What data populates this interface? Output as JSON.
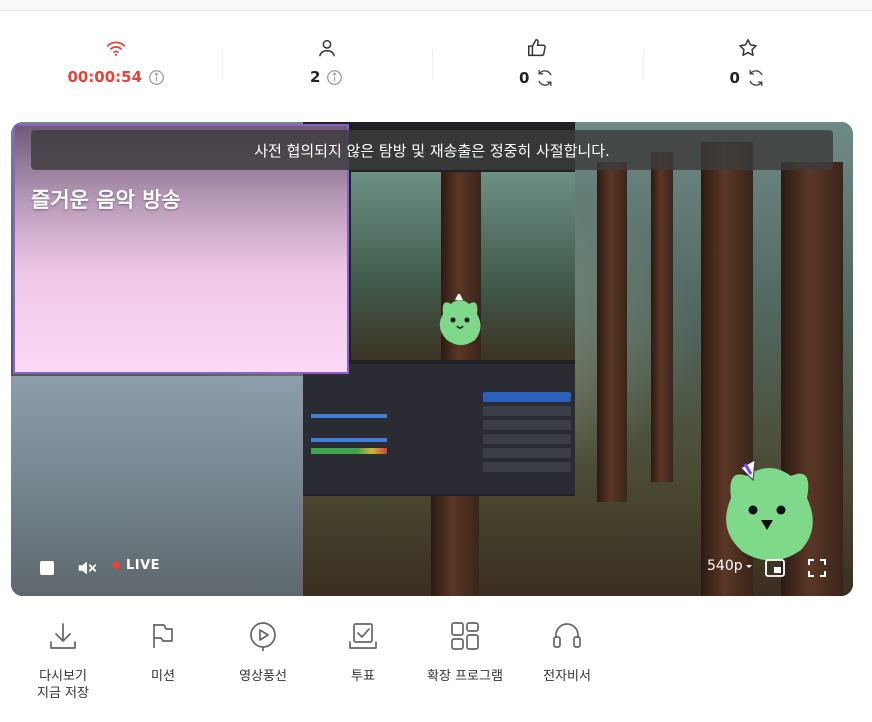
{
  "stats": {
    "live_time": "00:00:54",
    "viewers": "2",
    "likes": "0",
    "favorites": "0"
  },
  "video": {
    "notice": "사전 협의되지 않은 탐방 및 재송출은 정중히 사절합니다.",
    "title": "즐거운 음악 방송",
    "live_label": "LIVE",
    "quality": "540p"
  },
  "tools": [
    {
      "label": "다시보기\n지금 저장",
      "icon": "download-icon"
    },
    {
      "label": "미션",
      "icon": "flag-icon"
    },
    {
      "label": "영상풍선",
      "icon": "video-balloon-icon"
    },
    {
      "label": "투표",
      "icon": "vote-icon"
    },
    {
      "label": "확장 프로그램",
      "icon": "extension-icon"
    },
    {
      "label": "전자비서",
      "icon": "headset-icon"
    }
  ],
  "colors": {
    "accent_red": "#e0453a",
    "live_dot": "#ff3b30",
    "overlay_border": "#8a5fd0"
  }
}
